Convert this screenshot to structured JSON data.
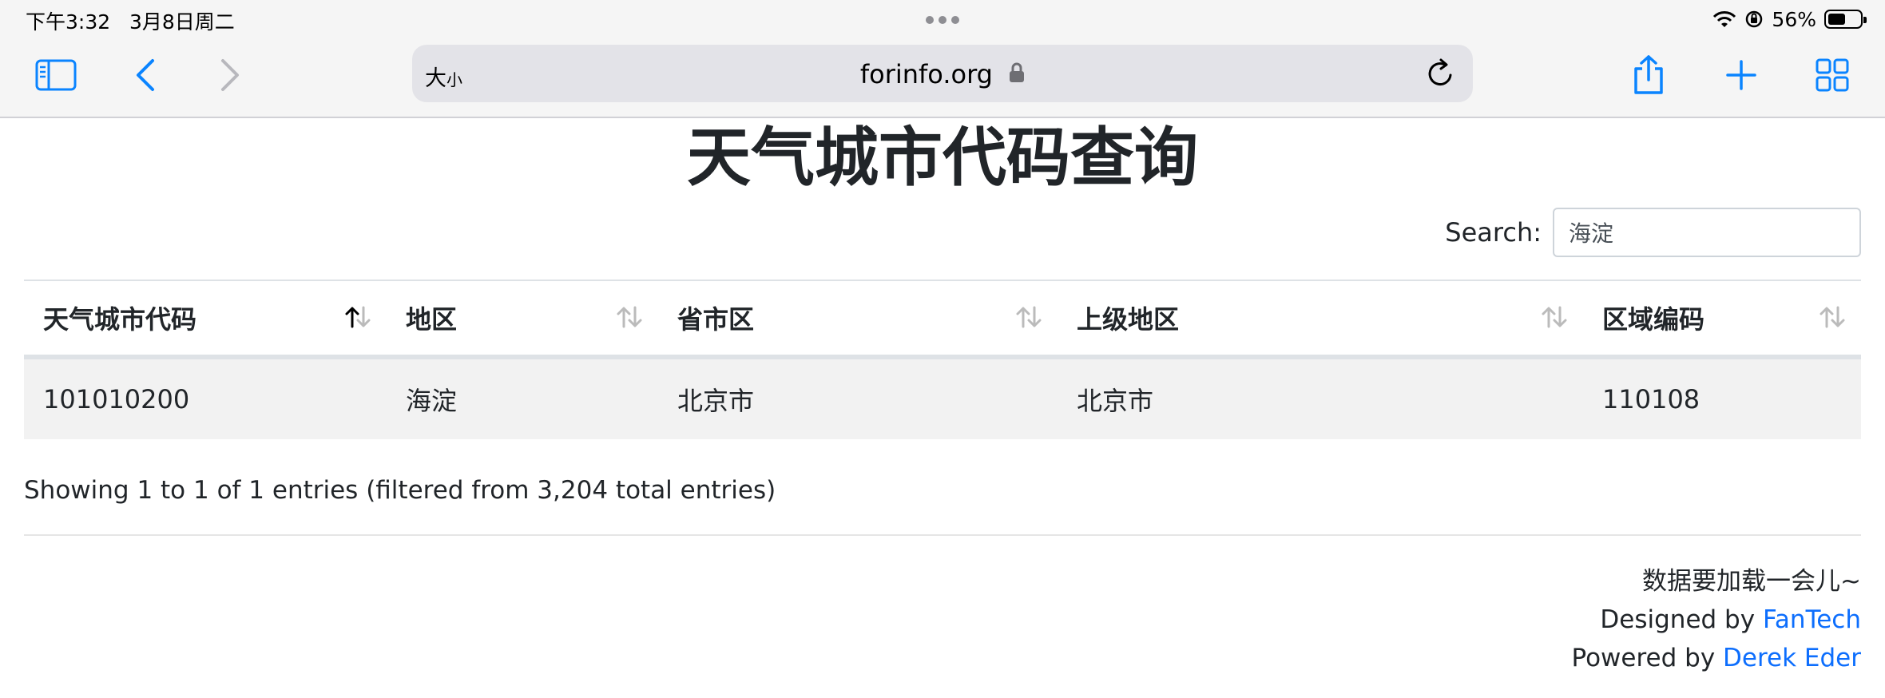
{
  "status_bar": {
    "time": "下午3:32",
    "date": "3月8日周二",
    "battery": "56%",
    "battery_level": 0.56
  },
  "browser": {
    "reader_size_label_big": "大",
    "reader_size_label_small": "小",
    "url": "forinfo.org",
    "accent": "#0a84ff"
  },
  "page": {
    "title": "天气城市代码查询",
    "search": {
      "label": "Search:",
      "value": "海淀"
    },
    "table": {
      "columns": [
        "天气城市代码",
        "地区",
        "省市区",
        "上级地区",
        "区域编码"
      ],
      "sorted_column": 0,
      "rows": [
        [
          "101010200",
          "海淀",
          "北京市",
          "北京市",
          "110108"
        ]
      ]
    },
    "info": "Showing 1 to 1 of 1 entries (filtered from 3,204 total entries)",
    "footer": {
      "note": "数据要加载一会儿~",
      "designed_prefix": "Designed by ",
      "designed_link": "FanTech",
      "powered_prefix": "Powered by ",
      "powered_link": "Derek Eder"
    }
  }
}
